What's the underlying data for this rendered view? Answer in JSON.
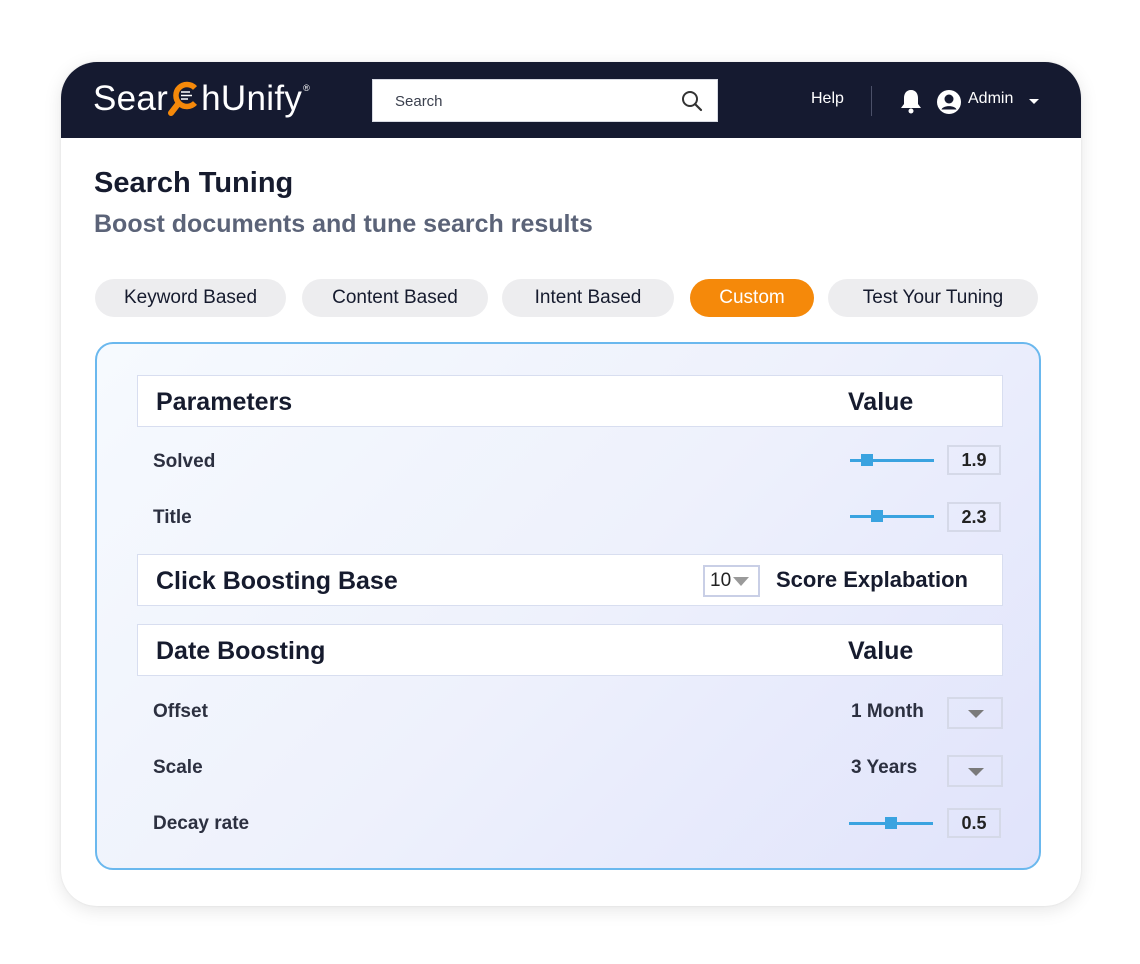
{
  "header": {
    "logo_text_before": "Sear",
    "logo_text_after": "hUnify",
    "logo_registered": "®",
    "search": {
      "placeholder": "Search",
      "value": ""
    },
    "help_label": "Help",
    "user_label": "Admin",
    "icons": [
      "search-icon",
      "bell-icon",
      "user-circle-icon",
      "caret-down-icon"
    ]
  },
  "page": {
    "title": "Search Tuning",
    "subtitle": "Boost documents and tune search results"
  },
  "tabs": [
    {
      "label": "Keyword Based",
      "active": false
    },
    {
      "label": "Content Based",
      "active": false
    },
    {
      "label": "Intent Based",
      "active": false
    },
    {
      "label": "Custom",
      "active": true
    },
    {
      "label": "Test Your Tuning",
      "active": false
    }
  ],
  "colors": {
    "accent": "#f5890a",
    "header_bg": "#151a30",
    "slider": "#3aa3e0",
    "panel_border": "#6ab8ee"
  },
  "parameters": {
    "header_label": "Parameters",
    "value_label": "Value",
    "rows": [
      {
        "label": "Solved",
        "value": "1.9",
        "slider_fraction": 0.2
      },
      {
        "label": "Title",
        "value": "2.3",
        "slider_fraction": 0.32
      }
    ]
  },
  "click_boosting": {
    "label": "Click Boosting Base",
    "select_value": "10",
    "score_explanation_label": "Score Explabation"
  },
  "date_boosting": {
    "header_label": "Date Boosting",
    "value_label": "Value",
    "offset": {
      "label": "Offset",
      "value": "1 Month"
    },
    "scale": {
      "label": "Scale",
      "value": "3 Years"
    },
    "decay": {
      "label": "Decay rate",
      "value": "0.5",
      "slider_fraction": 0.5
    }
  }
}
